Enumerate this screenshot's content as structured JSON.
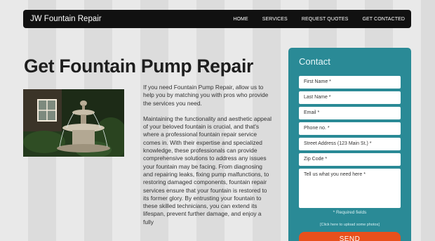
{
  "nav": {
    "brand": "JW Fountain Repair",
    "items": [
      "HOME",
      "SERVICES",
      "REQUEST QUOTES",
      "GET CONTACTED"
    ]
  },
  "main": {
    "title": "Get Fountain Pump Repair",
    "paragraph1": "If you need Fountain Pump Repair, allow us to help you by matching you with pros who provide the services you need.",
    "paragraph2": "Maintaining the functionality and aesthetic appeal of your beloved fountain is crucial, and that's where a professional fountain repair service comes in. With their expertise and specialized knowledge, these professionals can provide comprehensive solutions to address any issues your fountain may be facing. From diagnosing and repairing leaks, fixing pump malfunctions, to restoring damaged components, fountain repair services ensure that your fountain is restored to its former glory. By entrusting your fountain to these skilled technicians, you can extend its lifespan, prevent further damage, and enjoy a fully"
  },
  "contact": {
    "title": "Contact",
    "fields": {
      "first_name": "First Name *",
      "last_name": "Last Name *",
      "email": "Email *",
      "phone": "Phone no. *",
      "street": "Street Address (123 Main St.) *",
      "zip": "Zip Code *",
      "message": "Tell us what you need here *"
    },
    "required_note": "* Required fields",
    "upload_link": "[Click here to upload some photos]",
    "send_label": "SEND"
  },
  "colors": {
    "navbar": "#111111",
    "card": "#2a8a96",
    "send": "#e8501c"
  }
}
